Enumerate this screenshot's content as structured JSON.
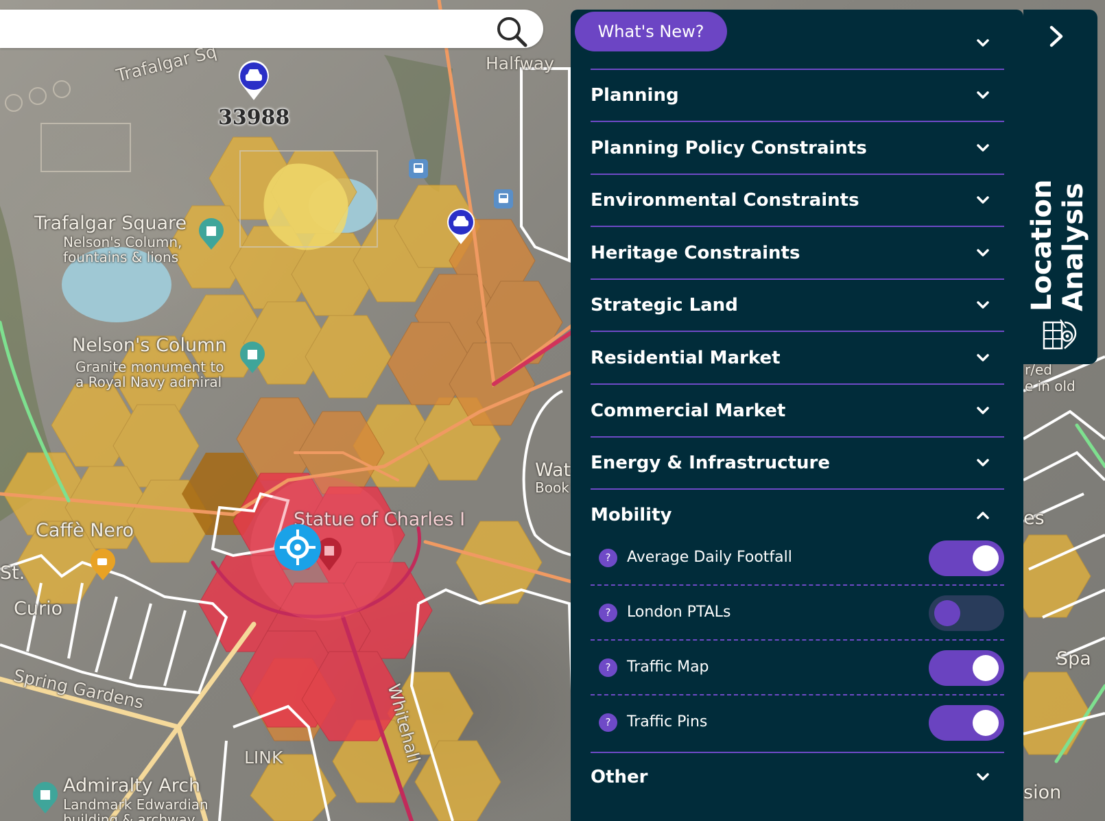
{
  "search": {
    "value": "",
    "placeholder": ""
  },
  "map": {
    "labels": {
      "trafalgar_sq_road": "Trafalgar Sq",
      "halfway": "Halfway",
      "traffic_count": "33988",
      "trafalgar_square": "Trafalgar Square",
      "trafalgar_square_sub1": "Nelson's Column,",
      "trafalgar_square_sub2": "fountains & lions",
      "nelsons_column": "Nelson's Column",
      "nelsons_column_sub1": "Granite monument to",
      "nelsons_column_sub2": "a Royal Navy admiral",
      "caffe_nero": "Caffè Nero",
      "st_curio1": "St.",
      "st_curio2": "Curio",
      "statue": "Statue of Charles I",
      "spring_gardens": "Spring Gardens",
      "whitehall": "Whitehall",
      "link": "LINK",
      "admiralty_arch": "Admiralty Arch",
      "admiralty_sub1": "Landmark Edwardian",
      "admiralty_sub2": "building & archway",
      "wat": "Wat",
      "book": "Book",
      "right_es": "es",
      "right_spa": "Spa",
      "right_ion": "sion",
      "right_top": "r/ed",
      "right_top2": "e in old"
    }
  },
  "panel": {
    "whats_new": "What's New?",
    "sections": [
      {
        "label": ""
      },
      {
        "label": "Planning"
      },
      {
        "label": "Planning Policy Constraints"
      },
      {
        "label": "Environmental Constraints"
      },
      {
        "label": "Heritage Constraints"
      },
      {
        "label": "Strategic Land"
      },
      {
        "label": "Residential Market"
      },
      {
        "label": "Commercial Market"
      },
      {
        "label": "Energy & Infrastructure"
      }
    ],
    "mobility": {
      "label": "Mobility",
      "expanded": true,
      "layers": [
        {
          "label": "Average Daily Footfall",
          "enabled": true
        },
        {
          "label": "London PTALs",
          "enabled": false
        },
        {
          "label": "Traffic Map",
          "enabled": true
        },
        {
          "label": "Traffic Pins",
          "enabled": true
        }
      ]
    },
    "other": {
      "label": "Other"
    },
    "help_glyph": "?"
  },
  "side_tab": {
    "title": "Location Analysis"
  },
  "colors": {
    "panel_bg": "#012c3a",
    "accent_purple": "#6c45c4",
    "toggle_off": "#293c5b",
    "hex_yellow": "#e5b43a",
    "hex_orange": "#d68a35",
    "hex_red": "#e83a4d"
  },
  "icons": [
    "search-icon",
    "chevron-down-icon",
    "chevron-up-icon",
    "chevron-right-icon",
    "help-icon",
    "car-pin-icon",
    "bus-stop-icon",
    "location-target-icon",
    "location-analysis-icon"
  ]
}
